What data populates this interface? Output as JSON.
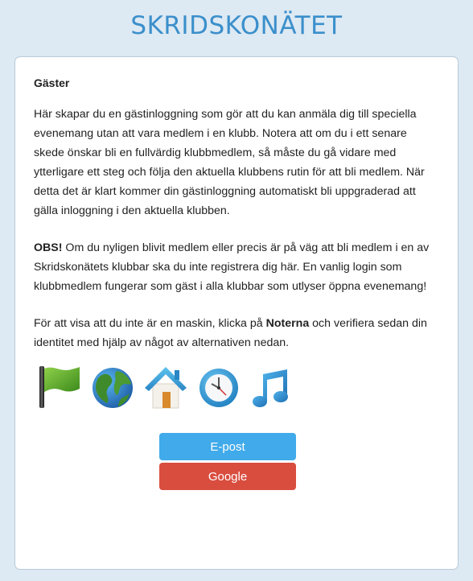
{
  "header": {
    "logo_text": "SKRIDSKONÄTET"
  },
  "card": {
    "title": "Gäster",
    "intro": "Här skapar du en gästinloggning som gör att du kan anmäla dig till speciella evenemang utan att vara medlem i en klubb. Notera att om du i ett senare skede önskar bli en fullvärdig klubbmedlem, så måste du gå vidare med ytterligare ett steg och följa den aktuella klubbens rutin för att bli medlem. När detta det är klart kommer din gästinloggning automatiskt bli uppgraderad att gälla inloggning i den aktuella klubben.",
    "obs_label": "OBS!",
    "obs_text": " Om du nyligen blivit medlem eller precis är på väg att bli medlem i en av Skridskonätets klubbar ska du inte registrera dig här. En vanlig login som klubbmedlem fungerar som gäst i alla klubbar som utlyser öppna evenemang!",
    "captcha_pre": "För att visa att du inte är en maskin, klicka på ",
    "captcha_target": "Noterna",
    "captcha_post": " och verifiera sedan din identitet med hjälp av något av alternativen nedan.",
    "captcha_icons": [
      "flag-icon",
      "globe-icon",
      "house-icon",
      "clock-icon",
      "music-notes-icon"
    ]
  },
  "buttons": {
    "email_label": "E-post",
    "google_label": "Google"
  },
  "colors": {
    "background": "#dde9f3",
    "accent": "#3b8fcb",
    "email": "#40aaea",
    "google": "#d94d3f"
  }
}
